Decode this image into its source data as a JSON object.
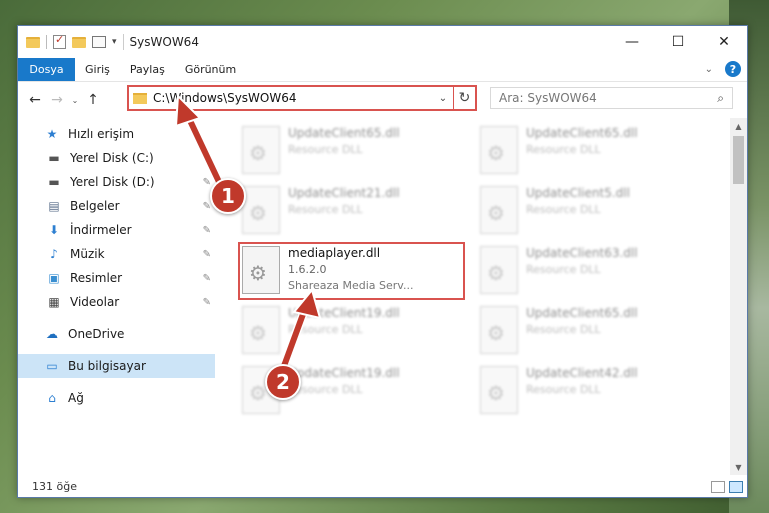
{
  "window": {
    "title": "SysWOW64",
    "minimize": "—",
    "maximize": "☐",
    "close": "✕"
  },
  "ribbon": {
    "tabs": [
      "Dosya",
      "Giriş",
      "Paylaş",
      "Görünüm"
    ],
    "help": "?",
    "collapse": "⌄"
  },
  "nav": {
    "back": "←",
    "forward": "→",
    "recent": "⌄",
    "up": "↑",
    "address_path": "C:\\Windows\\SysWOW64",
    "address_dropdown": "⌄",
    "refresh": "↻",
    "search_placeholder": "Ara: SysWOW64",
    "search_icon": "⌕"
  },
  "sidebar": {
    "items": [
      {
        "label": "Hızlı erişim",
        "icon": "star-icon",
        "glyph": "★",
        "pinned": false
      },
      {
        "label": "Yerel Disk (C:)",
        "icon": "drive-icon",
        "glyph": "▬",
        "pinned": true
      },
      {
        "label": "Yerel Disk (D:)",
        "icon": "drive-icon",
        "glyph": "▬",
        "pinned": true
      },
      {
        "label": "Belgeler",
        "icon": "document-icon",
        "glyph": "▤",
        "pinned": true
      },
      {
        "label": "İndirmeler",
        "icon": "download-icon",
        "glyph": "⬇",
        "pinned": true
      },
      {
        "label": "Müzik",
        "icon": "music-icon",
        "glyph": "♪",
        "pinned": true
      },
      {
        "label": "Resimler",
        "icon": "picture-icon",
        "glyph": "▣",
        "pinned": true
      },
      {
        "label": "Videolar",
        "icon": "video-icon",
        "glyph": "▦",
        "pinned": true
      },
      {
        "label": "OneDrive",
        "icon": "cloud-icon",
        "glyph": "☁",
        "pinned": false
      },
      {
        "label": "Bu bilgisayar",
        "icon": "computer-icon",
        "glyph": "▭",
        "pinned": false
      },
      {
        "label": "Ağ",
        "icon": "network-icon",
        "glyph": "⌂",
        "pinned": false
      }
    ],
    "pin_glyph": "✎"
  },
  "files": [
    {
      "name": "UpdateClient65.dll",
      "desc": "Resource DLL"
    },
    {
      "name": "UpdateClient65.dll",
      "desc": "Resource DLL"
    },
    {
      "name": "UpdateClient21.dll",
      "desc": "Resource DLL"
    },
    {
      "name": "UpdateClient5.dll",
      "desc": "Resource DLL"
    },
    {
      "name": "mediaplayer.dll",
      "version": "1.6.2.0",
      "desc": "Shareaza Media Serv..."
    },
    {
      "name": "UpdateClient63.dll",
      "desc": "Resource DLL"
    },
    {
      "name": "UpdateClient19.dll",
      "desc": "Resource DLL"
    },
    {
      "name": "UpdateClient65.dll",
      "desc": "Resource DLL"
    },
    {
      "name": "UpdateClient19.dll",
      "desc": "Resource DLL"
    },
    {
      "name": "UpdateClient42.dll",
      "desc": "Resource DLL"
    }
  ],
  "status": {
    "count": "131 öğe"
  },
  "callouts": [
    "1",
    "2"
  ],
  "colors": {
    "accent": "#1979ca",
    "highlight": "#d9534f",
    "selected": "#cce4f7",
    "badge": "#c0392b"
  }
}
